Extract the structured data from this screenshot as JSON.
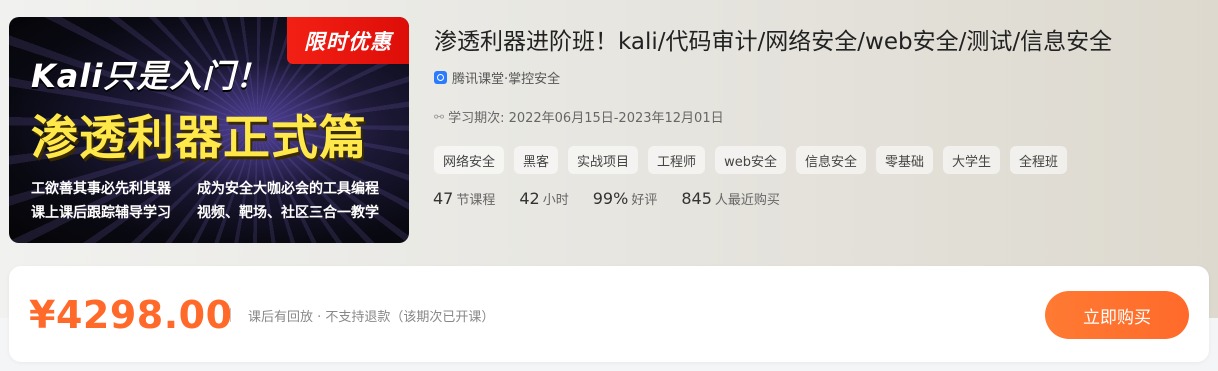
{
  "cover": {
    "badge": "限时优惠",
    "subtitle": "Kali只是入门！",
    "headline": "渗透利器正式篇",
    "lines": [
      [
        "工欲善其事必先利其器",
        "成为安全大咖必会的工具编程"
      ],
      [
        "课上课后跟踪辅导学习",
        "视频、靶场、社区三合一教学"
      ]
    ]
  },
  "course": {
    "title": "渗透利器进阶班！kali/代码审计/网络安全/web安全/测试/信息安全",
    "provider": "腾讯课堂·掌控安全",
    "provider_icon": "tencent-classroom-icon",
    "period": "学习期次: 2022年06月15日-2023年12月01日",
    "period_icon": "link-icon",
    "tags": [
      "网络安全",
      "黑客",
      "实战项目",
      "工程师",
      "web安全",
      "信息安全",
      "零基础",
      "大学生",
      "全程班"
    ],
    "stats": {
      "lessons": {
        "value": "47",
        "unit": "节课程"
      },
      "hours": {
        "value": "42",
        "unit": "小时"
      },
      "rating": {
        "value": "99%",
        "unit": "好评"
      },
      "buyers": {
        "value": "845",
        "unit": "人最近购买"
      }
    }
  },
  "purchase": {
    "price": "¥4298.00",
    "note": "课后有回放 · 不支持退款（该期次已开课）",
    "buy_label": "立即购买",
    "accent_color": "#ff6a2b"
  }
}
